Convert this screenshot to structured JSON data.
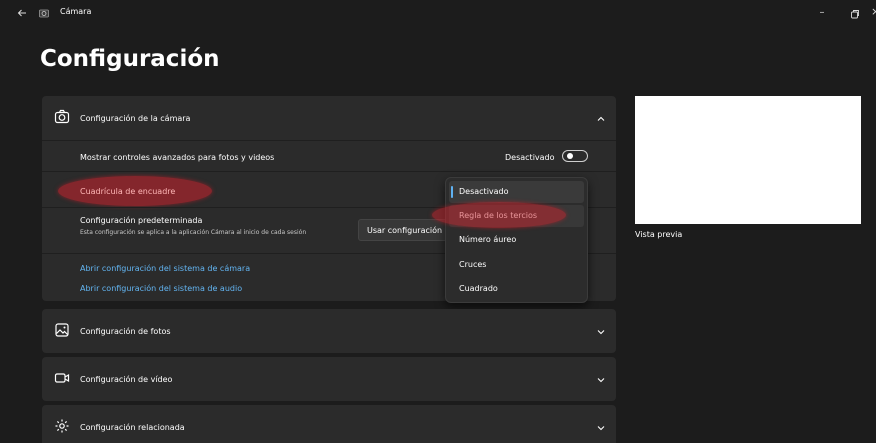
{
  "titlebar": {
    "back_icon": "back-arrow-icon",
    "app_icon": "camera-app-icon",
    "title": "Cámara",
    "minimize_glyph": "–",
    "close_glyph": "×"
  },
  "page": {
    "title": "Configuración"
  },
  "camera_settings": {
    "title": "Configuración de la cámara",
    "icon": "camera-icon",
    "expanded": true,
    "advanced_controls": {
      "label": "Mostrar controles avanzados para fotos y videos",
      "state_label": "Desactivado",
      "on": false
    },
    "grid": {
      "label": "Cuadrícula de encuadre"
    },
    "default_settings": {
      "label": "Configuración predeterminada",
      "description": "Esta configuración se aplica a la aplicación Cámara al inicio de cada sesión",
      "button_label": "Usar configuración predeterminada"
    },
    "links": [
      "Abrir configuración del sistema de cámara",
      "Abrir configuración del sistema de audio"
    ]
  },
  "grid_dropdown": {
    "options": [
      "Desactivado",
      "Regla de los tercios",
      "Número áureo",
      "Cruces",
      "Cuadrado"
    ],
    "selected_index": 0,
    "hover_index": 1
  },
  "photo_settings": {
    "title": "Configuración de fotos",
    "icon": "photo-icon"
  },
  "video_settings": {
    "title": "Configuración de vídeo",
    "icon": "video-icon"
  },
  "related_settings": {
    "title": "Configuración relacionada",
    "icon": "gear-icon"
  },
  "preview": {
    "label": "Vista previa"
  },
  "colors": {
    "background": "#1c1c1c",
    "card": "#2b2b2b",
    "link": "#63b5f2",
    "accent": "#5fb2f2",
    "annotation": "#cd232d"
  }
}
